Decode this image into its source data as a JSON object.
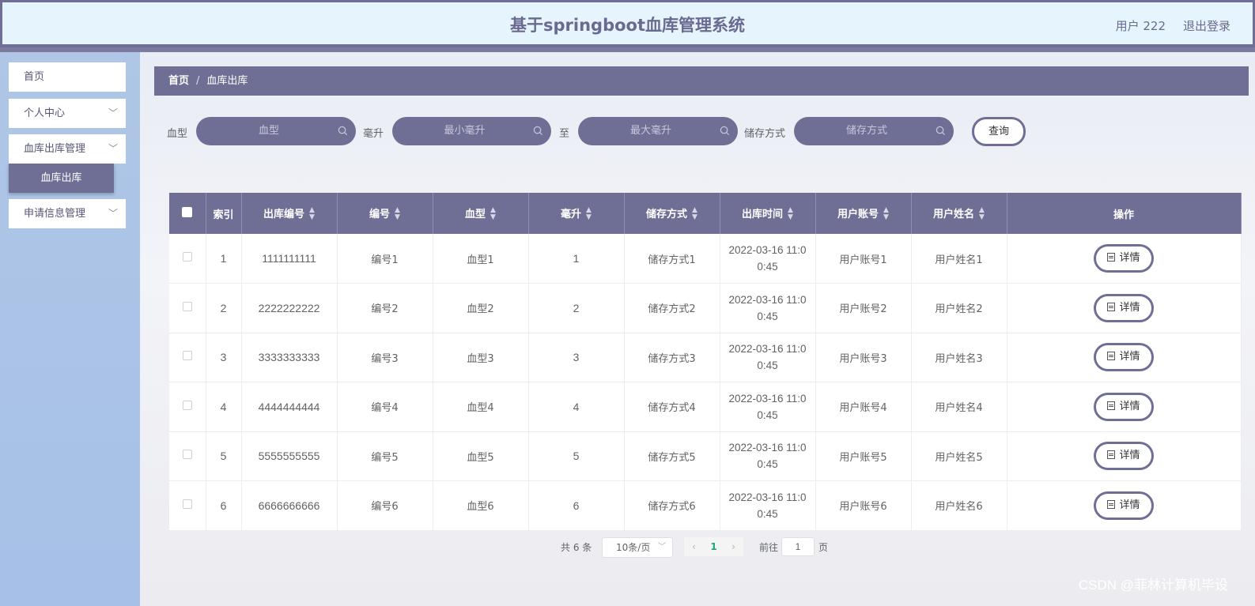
{
  "header": {
    "title": "基于springboot血库管理系统",
    "user": "用户 222",
    "logout": "退出登录"
  },
  "sidebar": {
    "items": [
      {
        "label": "首页",
        "has_children": false
      },
      {
        "label": "个人中心",
        "has_children": true
      },
      {
        "label": "血库出库管理",
        "has_children": true
      },
      {
        "label": "申请信息管理",
        "has_children": true
      }
    ],
    "active_submenu": "血库出库"
  },
  "breadcrumb": {
    "home": "首页",
    "separator": "/",
    "current": "血库出库"
  },
  "search": {
    "blood_type_label": "血型",
    "blood_type_placeholder": "血型",
    "ml_label": "毫升",
    "ml_min_placeholder": "最小毫升",
    "to_label": "至",
    "ml_max_placeholder": "最大毫升",
    "storage_label": "储存方式",
    "storage_placeholder": "储存方式",
    "query_button": "查询"
  },
  "table": {
    "columns": [
      "索引",
      "出库编号",
      "编号",
      "血型",
      "毫升",
      "储存方式",
      "出库时间",
      "用户账号",
      "用户姓名",
      "操作"
    ],
    "detail_label": "详情",
    "rows": [
      {
        "index": "1",
        "out_no": "1111111111",
        "code": "编号1",
        "blood": "血型1",
        "ml": "1",
        "storage": "储存方式1",
        "time_a": "2022-03-16 11:0",
        "time_b": "0:45",
        "account": "用户账号1",
        "name": "用户姓名1"
      },
      {
        "index": "2",
        "out_no": "2222222222",
        "code": "编号2",
        "blood": "血型2",
        "ml": "2",
        "storage": "储存方式2",
        "time_a": "2022-03-16 11:0",
        "time_b": "0:45",
        "account": "用户账号2",
        "name": "用户姓名2"
      },
      {
        "index": "3",
        "out_no": "3333333333",
        "code": "编号3",
        "blood": "血型3",
        "ml": "3",
        "storage": "储存方式3",
        "time_a": "2022-03-16 11:0",
        "time_b": "0:45",
        "account": "用户账号3",
        "name": "用户姓名3"
      },
      {
        "index": "4",
        "out_no": "4444444444",
        "code": "编号4",
        "blood": "血型4",
        "ml": "4",
        "storage": "储存方式4",
        "time_a": "2022-03-16 11:0",
        "time_b": "0:45",
        "account": "用户账号4",
        "name": "用户姓名4"
      },
      {
        "index": "5",
        "out_no": "5555555555",
        "code": "编号5",
        "blood": "血型5",
        "ml": "5",
        "storage": "储存方式5",
        "time_a": "2022-03-16 11:0",
        "time_b": "0:45",
        "account": "用户账号5",
        "name": "用户姓名5"
      },
      {
        "index": "6",
        "out_no": "6666666666",
        "code": "编号6",
        "blood": "血型6",
        "ml": "6",
        "storage": "储存方式6",
        "time_a": "2022-03-16 11:0",
        "time_b": "0:45",
        "account": "用户账号6",
        "name": "用户姓名6"
      }
    ]
  },
  "pagination": {
    "total": "共 6 条",
    "page_size": "10条/页",
    "current_page": "1",
    "goto_label": "前往",
    "goto_value": "1",
    "page_suffix": "页"
  },
  "watermark": "CSDN @菲林计算机毕设",
  "colors": {
    "primary": "#6f6f96",
    "header_bg": "#e6f5fd",
    "sidebar_bg": "#afc6e6",
    "active_page": "#1aa876"
  },
  "icons": {
    "search": "search-icon",
    "chevron": "chevron-down-icon",
    "detail": "document-icon",
    "sort": "sort-caret-icon"
  }
}
